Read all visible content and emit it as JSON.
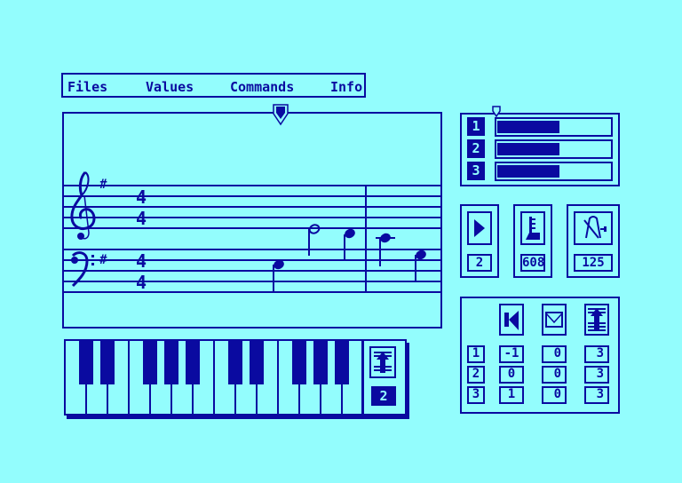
{
  "menu": {
    "items": [
      {
        "label": "Files"
      },
      {
        "label": "Values"
      },
      {
        "label": "Commands"
      },
      {
        "label": "Info"
      }
    ]
  },
  "score": {
    "treble_key_signature": "#",
    "bass_key_signature": "#",
    "time_signature": {
      "top": "4",
      "bottom": "4"
    },
    "notes": [
      {
        "type": "quarter",
        "staff": "bass"
      },
      {
        "type": "half",
        "staff": "treble-bass-gap"
      },
      {
        "type": "quarter",
        "staff": "treble-bass-gap"
      },
      {
        "type": "quarter",
        "staff": "ledger"
      },
      {
        "type": "quarter",
        "staff": "bass"
      }
    ]
  },
  "tracks": {
    "items": [
      {
        "label": "1",
        "level": 0.55
      },
      {
        "label": "2",
        "level": 0.55
      },
      {
        "label": "3",
        "level": 0.55
      }
    ]
  },
  "controls": {
    "play": {
      "icon": "play-icon",
      "value": "2"
    },
    "measure": {
      "icon": "level-gauge-icon",
      "value": "608"
    },
    "tempo": {
      "icon": "metronome-icon",
      "value": "125"
    }
  },
  "keyboard": {
    "octave_icon": "transpose-up-icon",
    "octave_value": "2"
  },
  "mixer": {
    "headers": [
      {
        "icon": "rewind-icon"
      },
      {
        "icon": "envelope-icon"
      },
      {
        "icon": "transpose-icon"
      }
    ],
    "rows": [
      {
        "track": "1",
        "values": [
          "-1",
          "0",
          "3"
        ]
      },
      {
        "track": "2",
        "values": [
          "0",
          "0",
          "3"
        ]
      },
      {
        "track": "3",
        "values": [
          "1",
          "0",
          "3"
        ]
      }
    ]
  },
  "colors": {
    "background": "#93fdfd",
    "foreground": "#0a0aa0"
  }
}
